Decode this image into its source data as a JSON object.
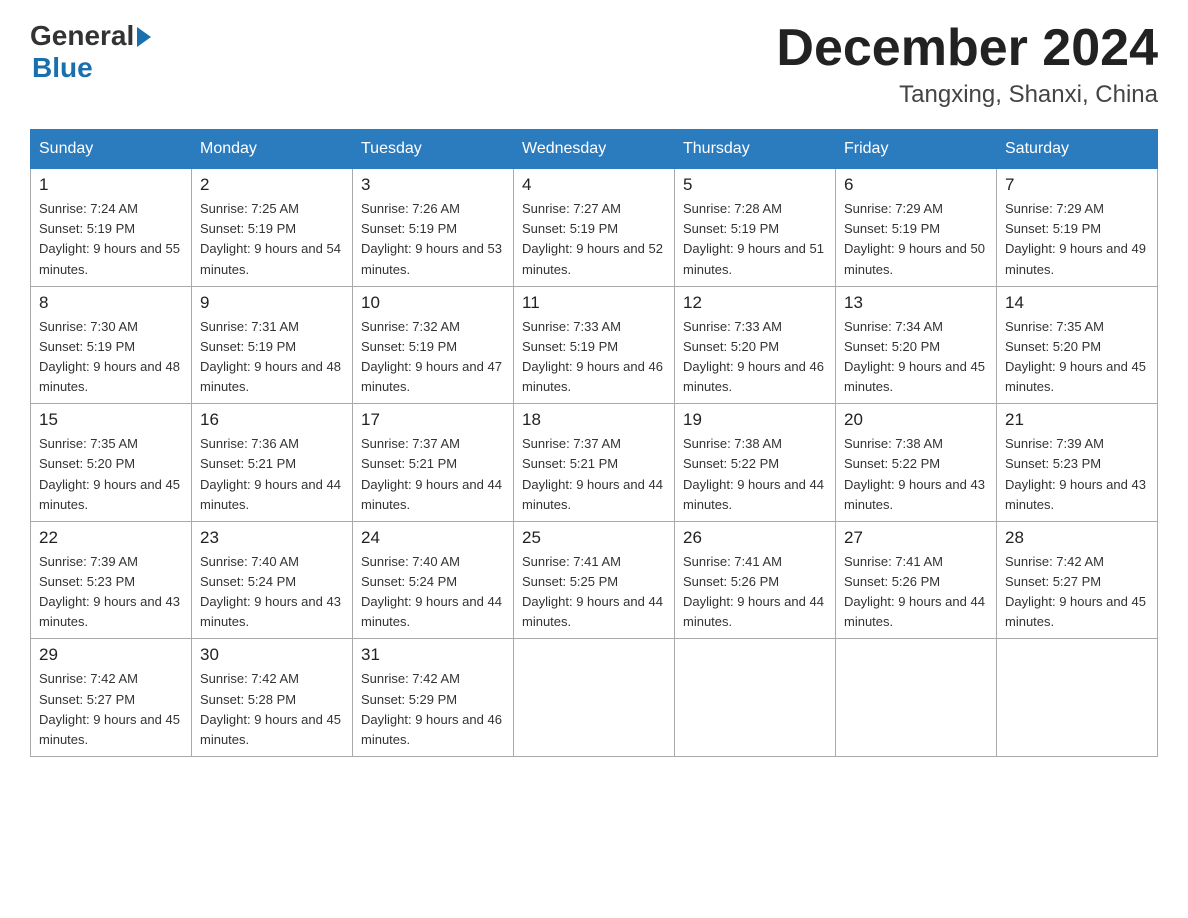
{
  "header": {
    "logo_general": "General",
    "logo_blue": "Blue",
    "month_title": "December 2024",
    "location": "Tangxing, Shanxi, China"
  },
  "weekdays": [
    "Sunday",
    "Monday",
    "Tuesday",
    "Wednesday",
    "Thursday",
    "Friday",
    "Saturday"
  ],
  "weeks": [
    [
      {
        "day": "1",
        "sunrise": "7:24 AM",
        "sunset": "5:19 PM",
        "daylight": "9 hours and 55 minutes."
      },
      {
        "day": "2",
        "sunrise": "7:25 AM",
        "sunset": "5:19 PM",
        "daylight": "9 hours and 54 minutes."
      },
      {
        "day": "3",
        "sunrise": "7:26 AM",
        "sunset": "5:19 PM",
        "daylight": "9 hours and 53 minutes."
      },
      {
        "day": "4",
        "sunrise": "7:27 AM",
        "sunset": "5:19 PM",
        "daylight": "9 hours and 52 minutes."
      },
      {
        "day": "5",
        "sunrise": "7:28 AM",
        "sunset": "5:19 PM",
        "daylight": "9 hours and 51 minutes."
      },
      {
        "day": "6",
        "sunrise": "7:29 AM",
        "sunset": "5:19 PM",
        "daylight": "9 hours and 50 minutes."
      },
      {
        "day": "7",
        "sunrise": "7:29 AM",
        "sunset": "5:19 PM",
        "daylight": "9 hours and 49 minutes."
      }
    ],
    [
      {
        "day": "8",
        "sunrise": "7:30 AM",
        "sunset": "5:19 PM",
        "daylight": "9 hours and 48 minutes."
      },
      {
        "day": "9",
        "sunrise": "7:31 AM",
        "sunset": "5:19 PM",
        "daylight": "9 hours and 48 minutes."
      },
      {
        "day": "10",
        "sunrise": "7:32 AM",
        "sunset": "5:19 PM",
        "daylight": "9 hours and 47 minutes."
      },
      {
        "day": "11",
        "sunrise": "7:33 AM",
        "sunset": "5:19 PM",
        "daylight": "9 hours and 46 minutes."
      },
      {
        "day": "12",
        "sunrise": "7:33 AM",
        "sunset": "5:20 PM",
        "daylight": "9 hours and 46 minutes."
      },
      {
        "day": "13",
        "sunrise": "7:34 AM",
        "sunset": "5:20 PM",
        "daylight": "9 hours and 45 minutes."
      },
      {
        "day": "14",
        "sunrise": "7:35 AM",
        "sunset": "5:20 PM",
        "daylight": "9 hours and 45 minutes."
      }
    ],
    [
      {
        "day": "15",
        "sunrise": "7:35 AM",
        "sunset": "5:20 PM",
        "daylight": "9 hours and 45 minutes."
      },
      {
        "day": "16",
        "sunrise": "7:36 AM",
        "sunset": "5:21 PM",
        "daylight": "9 hours and 44 minutes."
      },
      {
        "day": "17",
        "sunrise": "7:37 AM",
        "sunset": "5:21 PM",
        "daylight": "9 hours and 44 minutes."
      },
      {
        "day": "18",
        "sunrise": "7:37 AM",
        "sunset": "5:21 PM",
        "daylight": "9 hours and 44 minutes."
      },
      {
        "day": "19",
        "sunrise": "7:38 AM",
        "sunset": "5:22 PM",
        "daylight": "9 hours and 44 minutes."
      },
      {
        "day": "20",
        "sunrise": "7:38 AM",
        "sunset": "5:22 PM",
        "daylight": "9 hours and 43 minutes."
      },
      {
        "day": "21",
        "sunrise": "7:39 AM",
        "sunset": "5:23 PM",
        "daylight": "9 hours and 43 minutes."
      }
    ],
    [
      {
        "day": "22",
        "sunrise": "7:39 AM",
        "sunset": "5:23 PM",
        "daylight": "9 hours and 43 minutes."
      },
      {
        "day": "23",
        "sunrise": "7:40 AM",
        "sunset": "5:24 PM",
        "daylight": "9 hours and 43 minutes."
      },
      {
        "day": "24",
        "sunrise": "7:40 AM",
        "sunset": "5:24 PM",
        "daylight": "9 hours and 44 minutes."
      },
      {
        "day": "25",
        "sunrise": "7:41 AM",
        "sunset": "5:25 PM",
        "daylight": "9 hours and 44 minutes."
      },
      {
        "day": "26",
        "sunrise": "7:41 AM",
        "sunset": "5:26 PM",
        "daylight": "9 hours and 44 minutes."
      },
      {
        "day": "27",
        "sunrise": "7:41 AM",
        "sunset": "5:26 PM",
        "daylight": "9 hours and 44 minutes."
      },
      {
        "day": "28",
        "sunrise": "7:42 AM",
        "sunset": "5:27 PM",
        "daylight": "9 hours and 45 minutes."
      }
    ],
    [
      {
        "day": "29",
        "sunrise": "7:42 AM",
        "sunset": "5:27 PM",
        "daylight": "9 hours and 45 minutes."
      },
      {
        "day": "30",
        "sunrise": "7:42 AM",
        "sunset": "5:28 PM",
        "daylight": "9 hours and 45 minutes."
      },
      {
        "day": "31",
        "sunrise": "7:42 AM",
        "sunset": "5:29 PM",
        "daylight": "9 hours and 46 minutes."
      },
      null,
      null,
      null,
      null
    ]
  ]
}
